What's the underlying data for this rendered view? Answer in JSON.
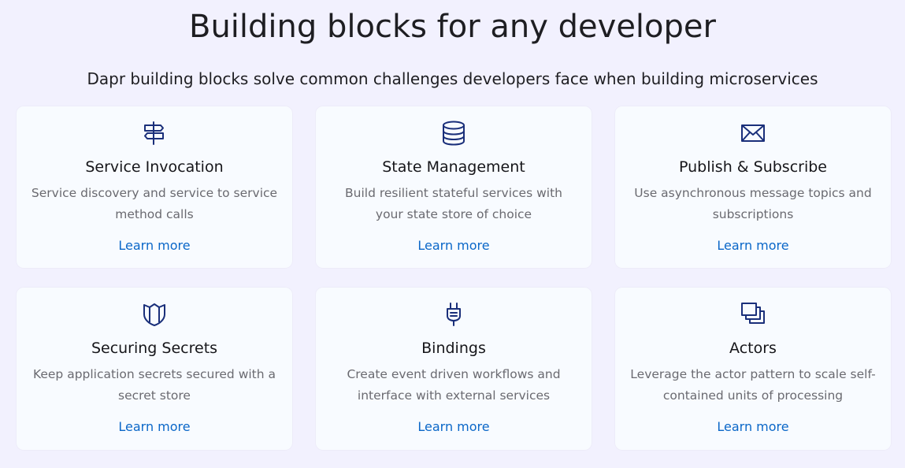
{
  "header": {
    "title": "Building blocks for any developer",
    "subtitle": "Dapr building blocks solve common challenges developers face when building microservices"
  },
  "colors": {
    "background": "#f2f1fe",
    "card": "#f8fbff",
    "icon": "#1a2f7a",
    "link": "#0b67c8"
  },
  "cards": [
    {
      "icon": "signpost-icon",
      "title": "Service Invocation",
      "description": "Service discovery and service to service method calls",
      "link": "Learn more"
    },
    {
      "icon": "database-icon",
      "title": "State Management",
      "description": "Build resilient stateful services with your state store of choice",
      "link": "Learn more"
    },
    {
      "icon": "envelope-icon",
      "title": "Publish & Subscribe",
      "description": "Use asynchronous message topics and subscriptions",
      "link": "Learn more"
    },
    {
      "icon": "shield-icon",
      "title": "Securing Secrets",
      "description": "Keep application secrets secured with a secret store",
      "link": "Learn more"
    },
    {
      "icon": "plug-icon",
      "title": "Bindings",
      "description": "Create event driven workflows and interface with external services",
      "link": "Learn more"
    },
    {
      "icon": "layers-icon",
      "title": "Actors",
      "description": "Leverage the actor pattern to scale self-contained units of processing",
      "link": "Learn more"
    }
  ]
}
